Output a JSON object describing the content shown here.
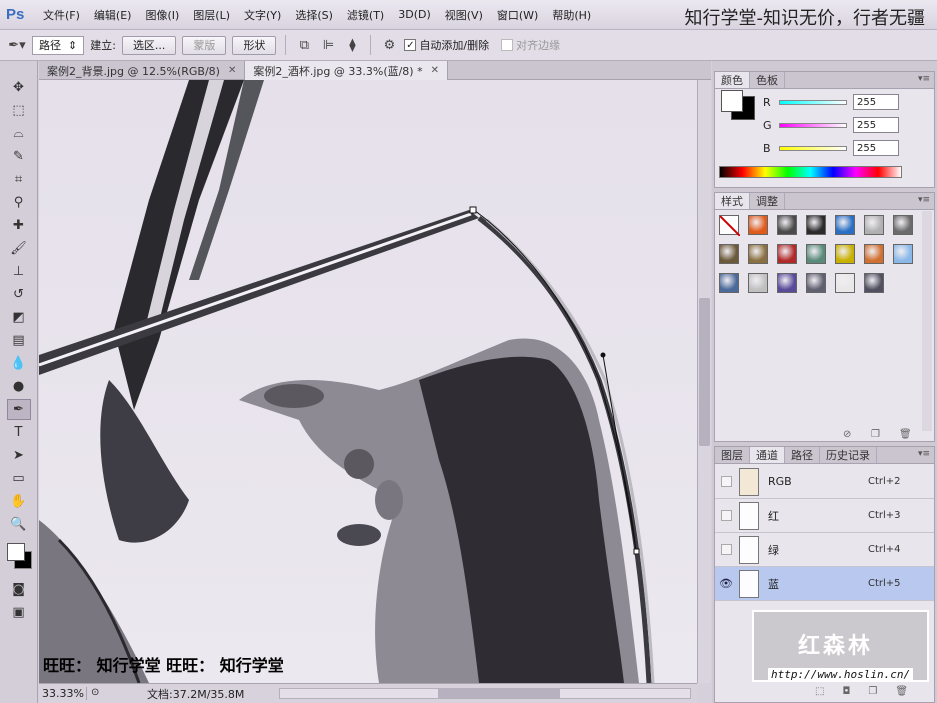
{
  "app": {
    "logo": "Ps"
  },
  "menu": [
    "文件(F)",
    "编辑(E)",
    "图像(I)",
    "图层(L)",
    "文字(Y)",
    "选择(S)",
    "滤镜(T)",
    "3D(D)",
    "视图(V)",
    "窗口(W)",
    "帮助(H)"
  ],
  "watermark_top": "知行学堂-知识无价，行者无疆",
  "options": {
    "mode_value": "路径",
    "build_label": "建立:",
    "selection_btn": "选区...",
    "mask_btn": "蒙版",
    "shape_btn": "形状",
    "auto_add_delete": "自动添加/删除",
    "align_edges": "对齐边缘"
  },
  "doc_tabs": [
    {
      "label": "案例2_背景.jpg @ 12.5%(RGB/8)",
      "active": false
    },
    {
      "label": "案例2_酒杯.jpg @ 33.3%(蓝/8) *",
      "active": true
    }
  ],
  "canvas_overlay": "旺旺：  知行学堂  旺旺：  知行学堂",
  "status": {
    "zoom": "33.33%",
    "doc": "文档:37.2M/35.8M"
  },
  "color_panel": {
    "tabs": [
      "颜色",
      "色板"
    ],
    "channels": [
      {
        "label": "R",
        "value": "255",
        "color_from": "#00ffff",
        "color_to": "#ffffff"
      },
      {
        "label": "G",
        "value": "255",
        "color_from": "#ff00ff",
        "color_to": "#ffffff"
      },
      {
        "label": "B",
        "value": "255",
        "color_from": "#ffff00",
        "color_to": "#ffffff"
      }
    ]
  },
  "styles_panel": {
    "tabs": [
      "样式",
      "调整"
    ],
    "swatches": [
      "#ffffff",
      "#e05a1a",
      "#4a4a4a",
      "#2b2b2b",
      "#2a6fc4",
      "#b0b0b0",
      "#6a6a6a",
      "#6b5a3a",
      "#8a7040",
      "#b02a2a",
      "#5a8a7a",
      "#c8b000",
      "#d07030",
      "#8ab8e8",
      "#4a6a9a",
      "#c0c0c0",
      "#5a4a9a",
      "#606070",
      "#e8e8e8",
      "#505060"
    ]
  },
  "channels_panel": {
    "tabs": [
      "图层",
      "通道",
      "路径",
      "历史记录"
    ],
    "rows": [
      {
        "name": "RGB",
        "shortcut": "Ctrl+2",
        "selected": false
      },
      {
        "name": "红",
        "shortcut": "Ctrl+3",
        "selected": false
      },
      {
        "name": "绿",
        "shortcut": "Ctrl+4",
        "selected": false
      },
      {
        "name": "蓝",
        "shortcut": "Ctrl+5",
        "selected": true
      }
    ]
  },
  "watermark_box": {
    "title": "红森林",
    "url": "http://www.hoslin.cn/"
  }
}
